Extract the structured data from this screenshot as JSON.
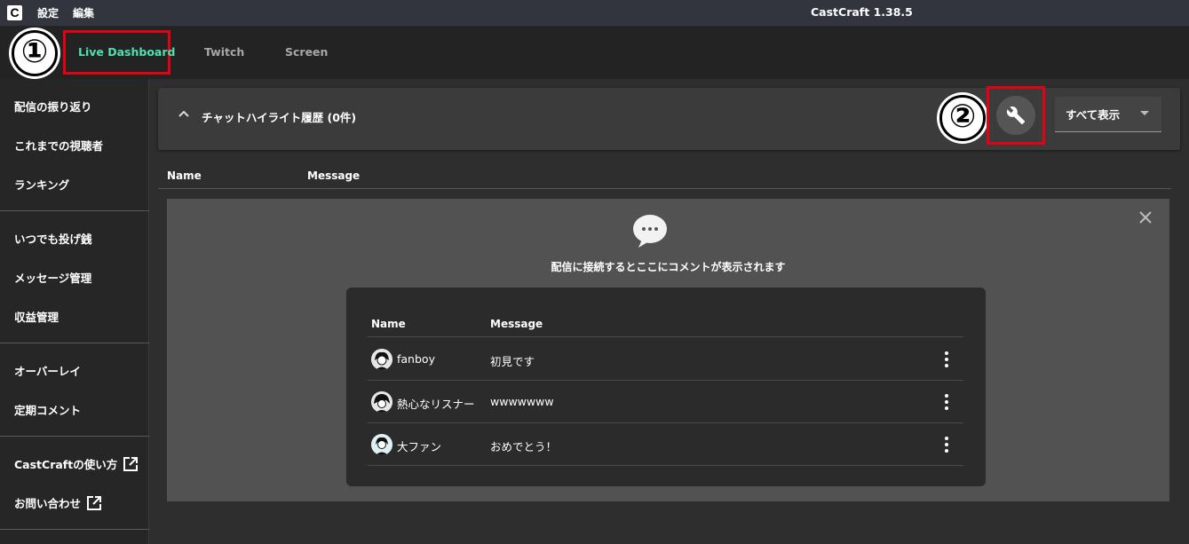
{
  "titlebar": {
    "logo": "C",
    "menu": [
      "設定",
      "編集"
    ],
    "title": "CastCraft 1.38.5"
  },
  "tabs": [
    {
      "label": "Live Dashboard",
      "active": true
    },
    {
      "label": "Twitch",
      "active": false
    },
    {
      "label": "Screen",
      "active": false
    }
  ],
  "annotations": {
    "num1": "①",
    "num2": "②",
    "box_color": "#e60012"
  },
  "sidebar": {
    "groups": [
      [
        "配信の振り返り",
        "これまでの視聴者",
        "ランキング"
      ],
      [
        "いつでも投げ銭",
        "メッセージ管理",
        "収益管理"
      ],
      [
        "オーバーレイ",
        "定期コメント"
      ],
      [
        "CastCraftの使い方",
        "お問い合わせ"
      ]
    ]
  },
  "highlight_panel": {
    "title": "チャットハイライト履歴 (0件)",
    "filter_value": "すべて表示"
  },
  "list_columns": {
    "name": "Name",
    "message": "Message"
  },
  "empty_state": {
    "message": "配信に接続するとここにコメントが表示されます"
  },
  "sample": {
    "columns": {
      "name": "Name",
      "message": "Message"
    },
    "rows": [
      {
        "name": "fanboy",
        "message": "初見です"
      },
      {
        "name": "熱心なリスナー",
        "message": "wwwwwww"
      },
      {
        "name": "大ファン",
        "message": "おめでとう！"
      }
    ]
  },
  "colors": {
    "accent": "#4fe0b0",
    "titlebar": "#32353e",
    "sidebar": "#262626",
    "panel": "#3b3b3b"
  }
}
